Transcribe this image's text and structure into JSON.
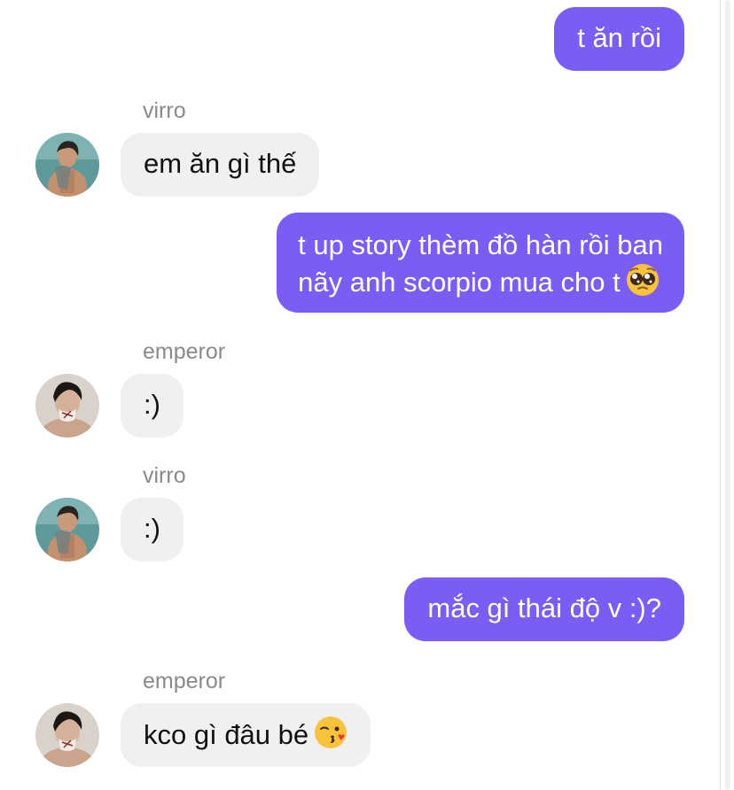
{
  "messages": [
    {
      "side": "out",
      "text": "t ăn rồi"
    },
    {
      "side": "in",
      "sender": "virro",
      "avatar": "virro-avatar",
      "text": "em ăn gì thế"
    },
    {
      "side": "out",
      "line1": "t up story thèm đồ hàn rồi ban",
      "line2": "nãy anh scorpio mua cho t",
      "emoji": "pleading-face-icon"
    },
    {
      "side": "in",
      "sender": "emperor",
      "avatar": "emperor-avatar",
      "text": ":)"
    },
    {
      "side": "in",
      "sender": "virro",
      "avatar": "virro-avatar",
      "text": ":)"
    },
    {
      "side": "out",
      "text": "mắc gì thái độ v :)?"
    },
    {
      "side": "in",
      "sender": "emperor",
      "avatar": "emperor-avatar",
      "text": "kco gì đâu bé",
      "emoji": "face-blowing-kiss-icon"
    }
  ],
  "colors": {
    "outgoing_bubble": "#7b5cf5",
    "incoming_bubble": "#f0f0f2",
    "sender_name": "#8a8a8e"
  }
}
